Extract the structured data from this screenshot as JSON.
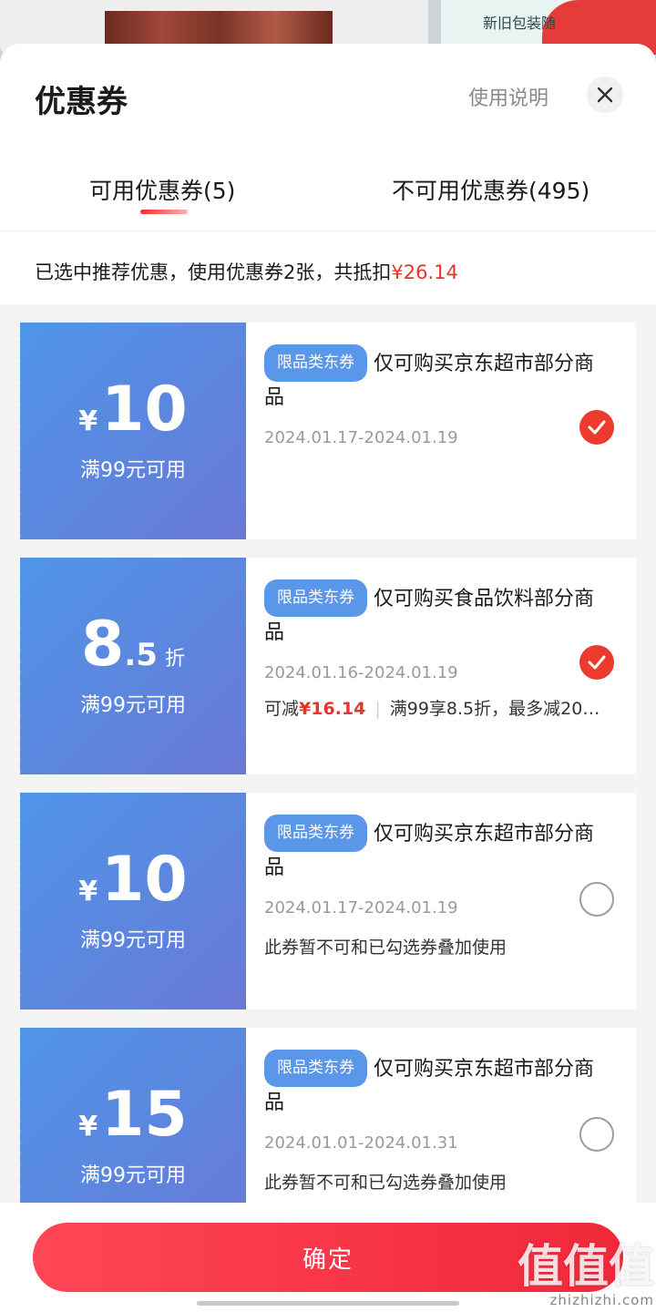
{
  "background": {
    "right_card_text": "新旧包装随"
  },
  "header": {
    "title": "优惠券",
    "help_label": "使用说明"
  },
  "tabs": [
    {
      "label": "可用优惠券(5)",
      "active": true
    },
    {
      "label": "不可用优惠券(495)",
      "active": false
    }
  ],
  "summary": {
    "text": "已选中推荐优惠，使用优惠券2张，共抵扣",
    "amount": "¥26.14"
  },
  "coupons": [
    {
      "currency": "¥",
      "value": "10",
      "decimal": "",
      "unit": "",
      "condition": "满99元可用",
      "tag": "限品类东券",
      "description": "仅可购买京东超市部分商品",
      "date_range": "2024.01.17-2024.01.19",
      "note": "",
      "selected": true
    },
    {
      "currency": "",
      "value": "8",
      "decimal": ".5",
      "unit": "折",
      "condition": "满99元可用",
      "tag": "限品类东券",
      "description": "仅可购买食品饮料部分商品",
      "date_range": "2024.01.16-2024.01.19",
      "note_prefix": "可减",
      "note_amount": "¥16.14",
      "note_rest": "满99享8.5折，最多减20…",
      "selected": true
    },
    {
      "currency": "¥",
      "value": "10",
      "decimal": "",
      "unit": "",
      "condition": "满99元可用",
      "tag": "限品类东券",
      "description": "仅可购买京东超市部分商品",
      "date_range": "2024.01.17-2024.01.19",
      "note": "此券暂不可和已勾选券叠加使用",
      "selected": false
    },
    {
      "currency": "¥",
      "value": "15",
      "decimal": "",
      "unit": "",
      "condition": "满99元可用",
      "tag": "限品类东券",
      "description": "仅可购买京东超市部分商品",
      "date_range": "2024.01.01-2024.01.31",
      "note": "此券暂不可和已勾选券叠加使用",
      "selected": false
    }
  ],
  "footer": {
    "confirm_label": "确定"
  },
  "watermark": {
    "logo": "值值值",
    "site": "zhizhizhi.com"
  },
  "colors": {
    "accent_red": "#e5342d",
    "coupon_blue": "#5b8ee4",
    "button_red": "#f0283a"
  }
}
